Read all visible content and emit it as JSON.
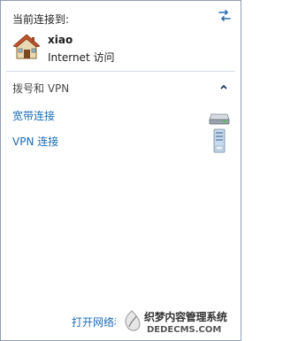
{
  "header": {
    "label": "当前连接到:"
  },
  "connection": {
    "name": "xiao",
    "status": "Internet 访问"
  },
  "section": {
    "title": "拨号和 VPN"
  },
  "items": [
    {
      "label": "宽带连接",
      "icon": "network-drive-icon"
    },
    {
      "label": "VPN 连接",
      "icon": "server-icon"
    }
  ],
  "footer": {
    "link": "打开网络和共享中心"
  },
  "watermark": {
    "title": "织梦内容管理系统",
    "url": "DEDECMS.COM"
  },
  "colors": {
    "link": "#1c6bb5",
    "border": "#8e9eb3"
  }
}
